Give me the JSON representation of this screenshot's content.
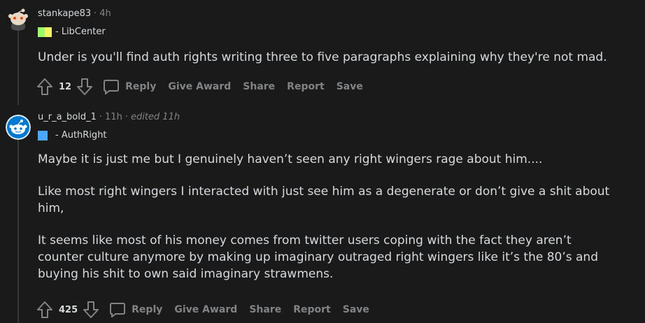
{
  "comments": [
    {
      "author": "stankape83",
      "time": "4h",
      "edited": "",
      "flair": "- LibCenter",
      "flair_colors": [
        "#9aff66",
        "#f5f565"
      ],
      "paragraphs": [
        "Under is you'll find auth rights writing three to five paragraphs explaining why they're not mad."
      ],
      "votes": "12",
      "actions": {
        "reply": "Reply",
        "give_award": "Give Award",
        "share": "Share",
        "report": "Report",
        "save": "Save"
      }
    },
    {
      "author": "u_r_a_bold_1",
      "time": "11h",
      "edited": "edited 11h",
      "flair": "- AuthRight",
      "flair_colors": [
        "#4aa8ff"
      ],
      "paragraphs": [
        "Maybe it is just me but I genuinely haven’t seen any right wingers rage about him....",
        "Like most right wingers I interacted with just see him as a degenerate or don’t give a shit about him,",
        "It seems like most of his money comes from twitter users coping with the fact they aren’t counter culture anymore by making up imaginary outraged right wingers like it’s the 80’s and buying his shit to own said imaginary strawmens."
      ],
      "votes": "425",
      "actions": {
        "reply": "Reply",
        "give_award": "Give Award",
        "share": "Share",
        "report": "Report",
        "save": "Save"
      }
    }
  ],
  "separator": "·",
  "icons": [
    "upvote-icon",
    "downvote-icon",
    "comment-bubble-icon",
    "avatar-icon"
  ]
}
